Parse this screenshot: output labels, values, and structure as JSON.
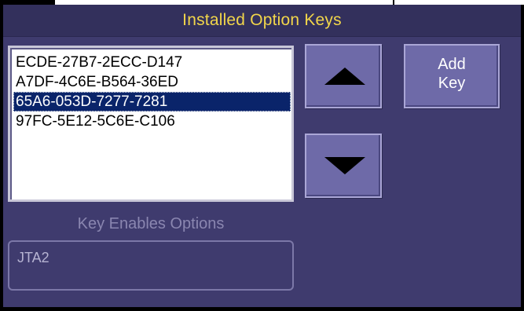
{
  "dialog": {
    "title": "Installed Option Keys"
  },
  "key_list": {
    "items": [
      "ECDE-27B7-2ECC-D147",
      "A7DF-4C6E-B564-36ED",
      "65A6-053D-7277-7281",
      "97FC-5E12-5C6E-C106"
    ],
    "selected_index": 2
  },
  "buttons": {
    "up_icon": "triangle-up-icon",
    "down_icon": "triangle-down-icon",
    "add_key_line1": "Add",
    "add_key_line2": "Key"
  },
  "enables": {
    "label": "Key Enables Options",
    "value": "JTA2"
  },
  "colors": {
    "panel_bg": "#3f3b6e",
    "title_text": "#f2d64a",
    "selection_bg": "#0a246a",
    "button_bg": "#6e6aa8"
  }
}
